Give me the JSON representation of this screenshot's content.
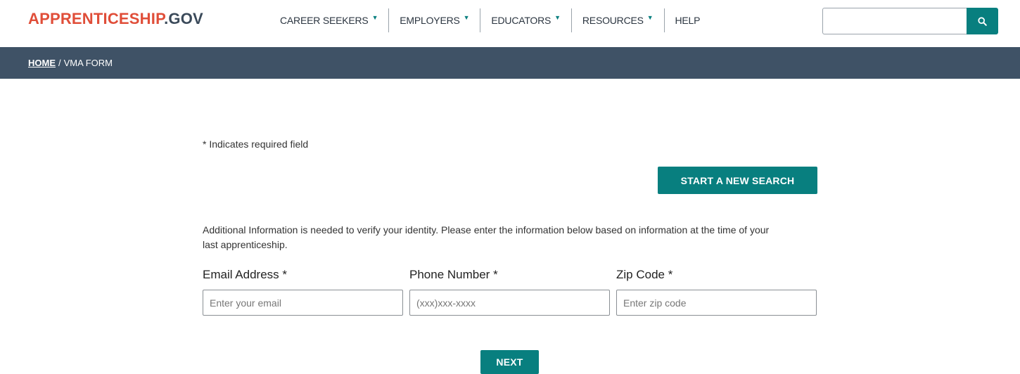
{
  "header": {
    "logo_brand": "APPRENTICESHIP",
    "logo_tld": ".GOV",
    "nav": [
      {
        "label": "CAREER SEEKERS",
        "caret": "▼"
      },
      {
        "label": "EMPLOYERS",
        "caret": "▼"
      },
      {
        "label": "EDUCATORS",
        "caret": "▼"
      },
      {
        "label": "RESOURCES",
        "caret": "▼"
      },
      {
        "label": "HELP"
      }
    ],
    "search": {
      "value": "",
      "placeholder": ""
    }
  },
  "breadcrumb": {
    "home": "HOME",
    "separator": "/",
    "current": "VMA FORM"
  },
  "form": {
    "required_note": "* Indicates required field",
    "start_new_search": "START A NEW SEARCH",
    "info": "Additional Information is needed to verify your identity. Please enter the information below based on information at the time of your last apprenticeship.",
    "fields": [
      {
        "label": "Email Address *",
        "placeholder": "Enter your email",
        "value": ""
      },
      {
        "label": "Phone Number *",
        "placeholder": "(xxx)xxx-xxxx",
        "value": ""
      },
      {
        "label": "Zip Code *",
        "placeholder": "Enter zip code",
        "value": ""
      }
    ],
    "next": "NEXT"
  },
  "colors": {
    "brand_red": "#e04e39",
    "teal": "#087f7f",
    "breadcrumb_bg": "#3f5266"
  },
  "icons": {
    "search": "search-icon",
    "caret": "caret-down-icon"
  }
}
